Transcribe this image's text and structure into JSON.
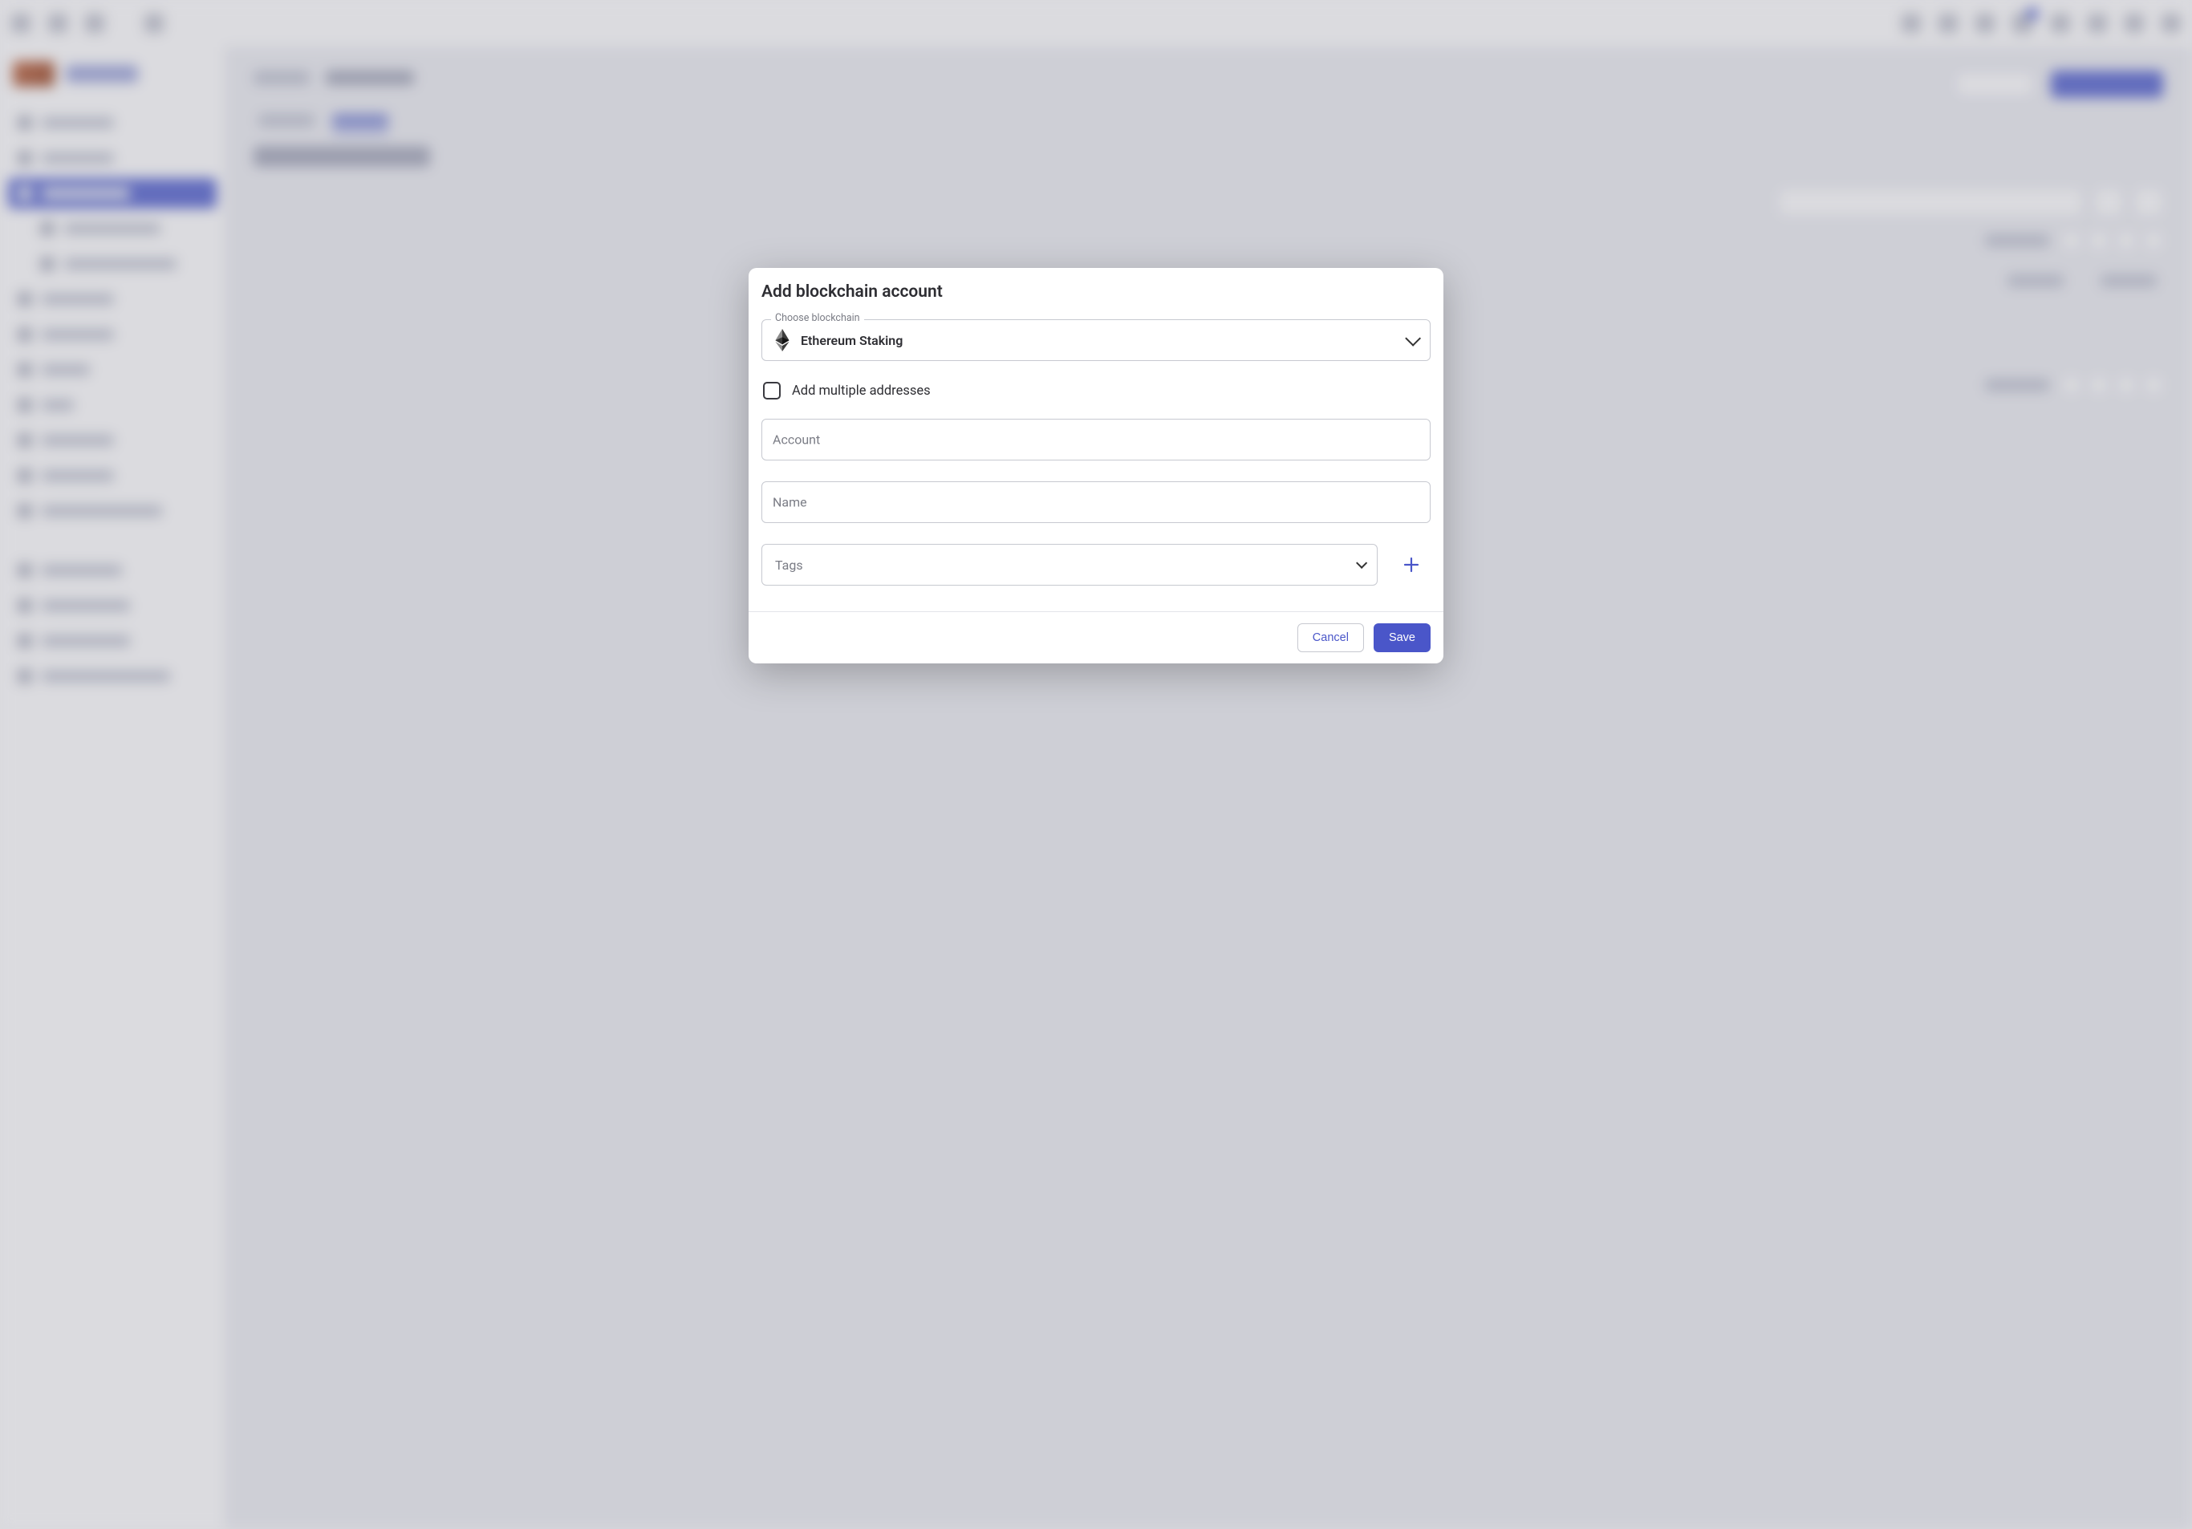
{
  "modal": {
    "title": "Add blockchain account",
    "choose_blockchain_label": "Choose blockchain",
    "choose_blockchain_value": "Ethereum Staking",
    "multi_addresses_label": "Add multiple addresses",
    "account_label": "Account",
    "name_label": "Name",
    "tags_label": "Tags",
    "cancel": "Cancel",
    "save": "Save"
  }
}
